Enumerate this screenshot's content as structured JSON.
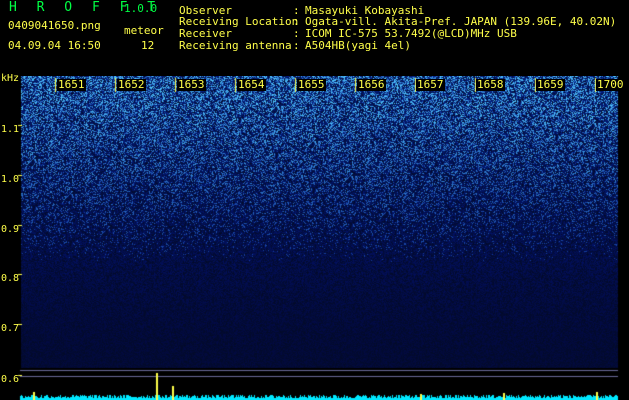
{
  "app": {
    "name": "H R O F F T",
    "version": "1.0.0"
  },
  "file": {
    "name": "0409041650.png",
    "datetime": "04.09.04 16:50"
  },
  "meteor": {
    "label": "meteor",
    "count": "12"
  },
  "info": {
    "observer_label": "Observer",
    "observer": "Masayuki Kobayashi",
    "location_label": "Receiving Location",
    "location": "Ogata-vill. Akita-Pref. JAPAN (139.96E, 40.02N)",
    "receiver_label": "Receiver",
    "receiver": "ICOM IC-575 53.7492(@LCD)MHz USB",
    "antenna_label": "Receiving antenna",
    "antenna": "A504HB(yagi 4el)",
    "separator": ":"
  },
  "spectrogram": {
    "y_unit": "kHz",
    "y_ticks": [
      "1.1",
      "1.0",
      "0.9",
      "0.8",
      "0.7",
      "0.6"
    ],
    "time_ticks": [
      "1651",
      "1652",
      "1653",
      "1654",
      "1655",
      "1656",
      "1657",
      "1658",
      "1659",
      "1700"
    ],
    "colors": {
      "background": "#000000",
      "label": "#ffff4a",
      "title": "#00ff44",
      "noise_high": "#3fb0ff",
      "baseline": "#00e8ff"
    }
  }
}
